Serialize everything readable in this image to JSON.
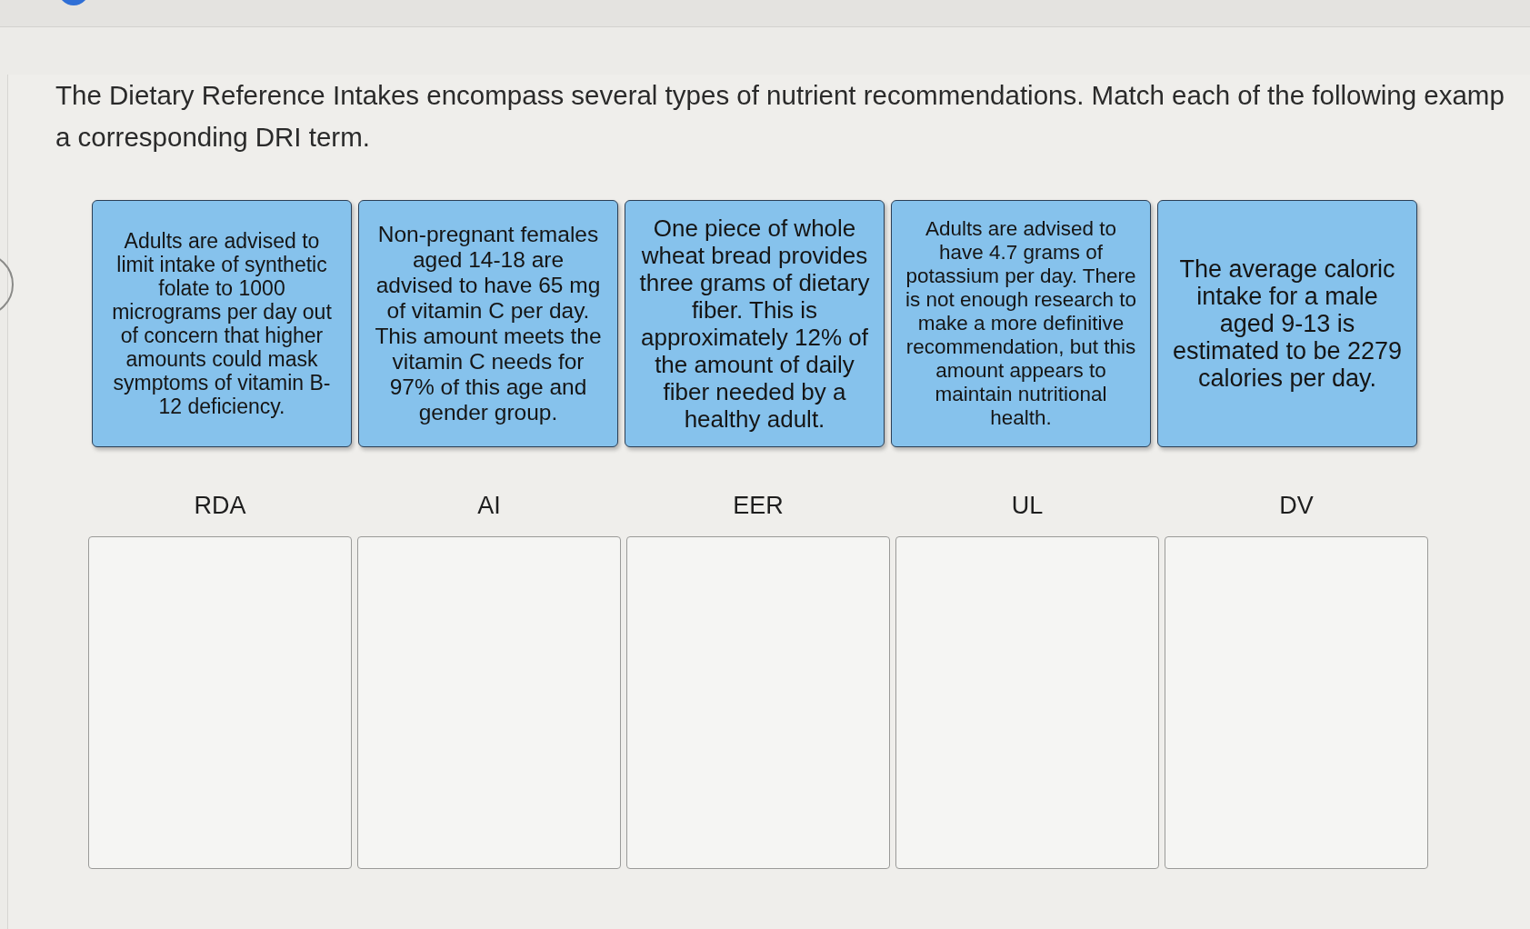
{
  "question": {
    "lines": [
      "The Dietary Reference Intakes encompass several types of nutrient recommendations. Match each of the following examp",
      "a corresponding DRI term."
    ]
  },
  "examples": [
    {
      "text": "Adults are advised to limit intake of synthetic folate to 1000 micrograms per day out of concern that higher amounts could mask symptoms of vitamin B-12 deficiency."
    },
    {
      "text": "Non-pregnant females aged 14-18 are advised to have 65 mg of vitamin C per day. This amount meets the vitamin C needs for 97% of this age and gender group."
    },
    {
      "text": "One piece of whole wheat bread provides three grams of dietary fiber. This is approximately 12% of the amount of daily fiber needed by a healthy adult."
    },
    {
      "text": "Adults are advised to have 4.7 grams of potassium per day. There is not enough research to make a more definitive recommendation, but this amount appears to maintain nutritional health."
    },
    {
      "text": "The average caloric intake for a male aged 9-13 is estimated to be 2279 calories per day."
    }
  ],
  "terms": [
    {
      "label": "RDA"
    },
    {
      "label": "AI"
    },
    {
      "label": "EER"
    },
    {
      "label": "UL"
    },
    {
      "label": "DV"
    }
  ]
}
